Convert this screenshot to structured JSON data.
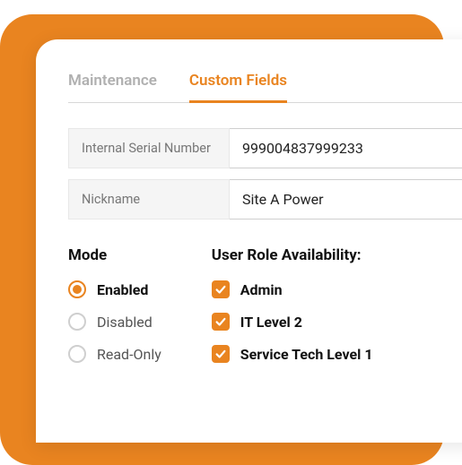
{
  "colors": {
    "accent": "#E98420"
  },
  "tabs": {
    "maintenance": "Maintenance",
    "customFields": "Custom Fields"
  },
  "fields": {
    "internalSerial": {
      "label": "Internal Serial Number",
      "value": "999004837999233"
    },
    "nickname": {
      "label": "Nickname",
      "value": "Site A Power"
    }
  },
  "mode": {
    "heading": "Mode",
    "options": {
      "enabled": "Enabled",
      "disabled": "Disabled",
      "readonly": "Read-Only"
    }
  },
  "userRoles": {
    "heading": "User Role Availability:",
    "options": {
      "admin": "Admin",
      "itLevel2": "IT Level 2",
      "serviceTech1": "Service Tech Level 1"
    }
  }
}
